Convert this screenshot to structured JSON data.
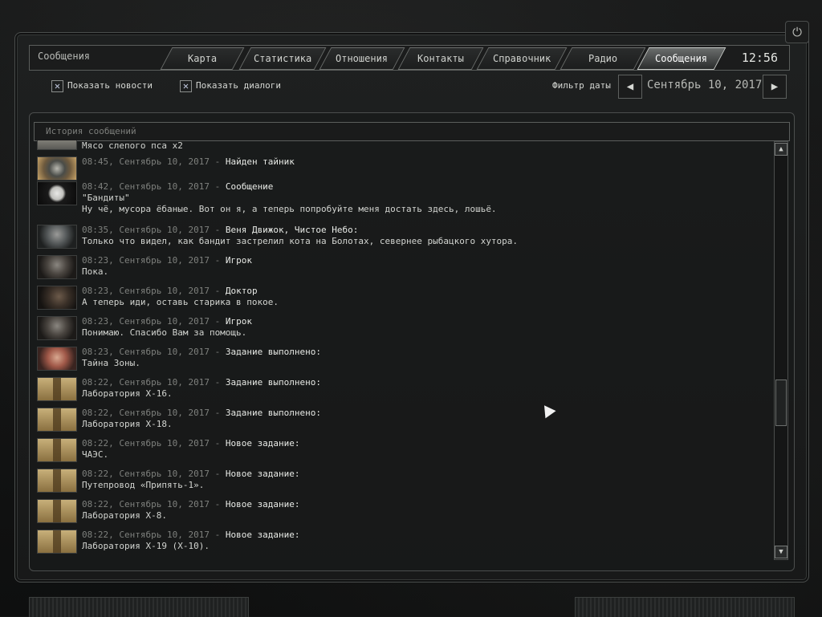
{
  "app_title": "Сообщения",
  "clock": "12:56",
  "tabs": [
    {
      "label": "Карта",
      "active": false
    },
    {
      "label": "Статистика",
      "active": false
    },
    {
      "label": "Отношения",
      "active": false
    },
    {
      "label": "Контакты",
      "active": false
    },
    {
      "label": "Справочник",
      "active": false
    },
    {
      "label": "Радио",
      "active": false
    },
    {
      "label": "Сообщения",
      "active": true
    }
  ],
  "filters": {
    "show_news": {
      "label": "Показать новости",
      "checked": true
    },
    "show_dialogs": {
      "label": "Показать диалоги",
      "checked": true
    },
    "check_mark": "✕"
  },
  "date_filter": {
    "label": "Фильтр даты",
    "value": "Сентябрь 10, 2017",
    "prev_icon": "◀",
    "next_icon": "▶"
  },
  "history": {
    "title": "История сообщений",
    "top_partial": "Мясо слепого пса x2",
    "messages": [
      {
        "time": "08:45, Сентябрь 10, 2017",
        "sep": " - ",
        "sender": "Найден тайник",
        "lines": [],
        "icon": "stash-icon"
      },
      {
        "time": "08:42, Сентябрь 10, 2017",
        "sep": " - ",
        "sender": "Сообщение",
        "lines": [
          "\"Бандиты\"",
          "Ну чё, мусора ёбаные. Вот он я, а теперь попробуйте меня достать здесь, лошьё."
        ],
        "icon": "bandits-skull-icon"
      },
      {
        "time": "08:35, Сентябрь 10, 2017",
        "sep": " - ",
        "sender": "Веня Движок, Чистое Небо:",
        "lines": [
          "Только что видел, как бандит застрелил кота на Болотах, севернее рыбацкого хутора."
        ],
        "icon": "stalker-portrait-icon"
      },
      {
        "time": "08:23, Сентябрь 10, 2017",
        "sep": " - ",
        "sender": "Игрок",
        "lines": [
          "Пока."
        ],
        "icon": "player-portrait-icon"
      },
      {
        "time": "08:23, Сентябрь 10, 2017",
        "sep": " - ",
        "sender": "Доктор",
        "lines": [
          "А теперь иди, оставь старика в покое."
        ],
        "icon": "doctor-portrait-icon"
      },
      {
        "time": "08:23, Сентябрь 10, 2017",
        "sep": " - ",
        "sender": "Игрок",
        "lines": [
          "Понимаю. Спасибо Вам за помощь."
        ],
        "icon": "player-portrait-icon"
      },
      {
        "time": "08:23, Сентябрь 10, 2017",
        "sep": " - ",
        "sender": "Задание выполнено:",
        "lines": [
          "Тайна Зоны."
        ],
        "icon": "task-complete-portrait-icon"
      },
      {
        "time": "08:22, Сентябрь 10, 2017",
        "sep": " - ",
        "sender": "Задание выполнено:",
        "lines": [
          "Лаборатория X-16."
        ],
        "icon": "task-icon"
      },
      {
        "time": "08:22, Сентябрь 10, 2017",
        "sep": " - ",
        "sender": "Задание выполнено:",
        "lines": [
          "Лаборатория X-18."
        ],
        "icon": "task-icon"
      },
      {
        "time": "08:22, Сентябрь 10, 2017",
        "sep": " - ",
        "sender": "Новое задание:",
        "lines": [
          "ЧАЭС."
        ],
        "icon": "task-icon"
      },
      {
        "time": "08:22, Сентябрь 10, 2017",
        "sep": " - ",
        "sender": "Новое задание:",
        "lines": [
          "Путепровод «Припять-1»."
        ],
        "icon": "task-icon"
      },
      {
        "time": "08:22, Сентябрь 10, 2017",
        "sep": " - ",
        "sender": "Новое задание:",
        "lines": [
          "Лаборатория X-8."
        ],
        "icon": "task-icon"
      },
      {
        "time": "08:22, Сентябрь 10, 2017",
        "sep": " - ",
        "sender": "Новое задание:",
        "lines": [
          "Лаборатория X-19 (X-10)."
        ],
        "icon": "task-icon"
      }
    ]
  },
  "scrollbar": {
    "up_icon": "▲",
    "down_icon": "▼"
  },
  "power_icon": "⏻"
}
